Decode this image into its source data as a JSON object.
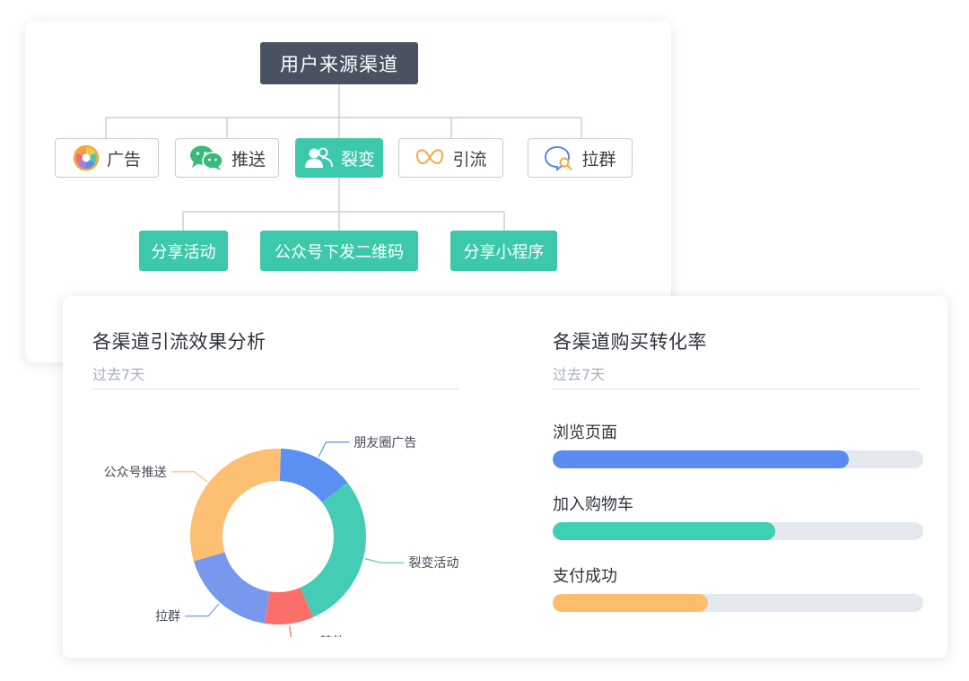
{
  "tree": {
    "root": "用户来源渠道",
    "channels": [
      {
        "label": "广告",
        "icon": "color-wheel-icon"
      },
      {
        "label": "推送",
        "icon": "wechat-icon"
      },
      {
        "label": "裂变",
        "icon": "users-icon",
        "active": true
      },
      {
        "label": "引流",
        "icon": "infinity-icon"
      },
      {
        "label": "拉群",
        "icon": "chat-search-icon"
      }
    ],
    "fission_children": [
      "分享活动",
      "公众号下发二维码",
      "分享小程序"
    ]
  },
  "traffic_panel": {
    "title": "各渠道引流效果分析",
    "subtitle": "过去7天"
  },
  "conversion_panel": {
    "title": "各渠道购买转化率",
    "subtitle": "过去7天",
    "bars": [
      {
        "label": "浏览页面",
        "value": 0.8,
        "color": "#5a8cf0"
      },
      {
        "label": "加入购物车",
        "value": 0.6,
        "color": "#3fcfb4"
      },
      {
        "label": "支付成功",
        "value": 0.42,
        "color": "#fdbd6e"
      }
    ]
  },
  "colors": {
    "accent": "#3cc8aa",
    "root_node": "#4a5262"
  },
  "chart_data": {
    "type": "pie",
    "variant": "donut",
    "slices": [
      {
        "name": "朋友圈广告",
        "value": 14,
        "color": "#5b8ff2"
      },
      {
        "name": "裂变活动",
        "value": 29,
        "color": "#44ccb5"
      },
      {
        "name": "其他",
        "value": 9,
        "color": "#fb6f6a"
      },
      {
        "name": "拉群",
        "value": 18,
        "color": "#7798ec"
      },
      {
        "name": "公众号推送",
        "value": 30,
        "color": "#fdbf72"
      }
    ]
  }
}
